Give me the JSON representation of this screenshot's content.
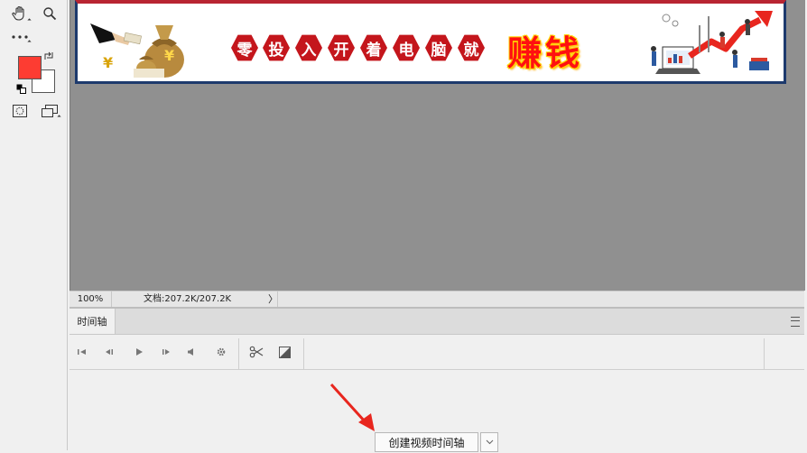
{
  "banner": {
    "chars": [
      "零",
      "投",
      "入",
      "开",
      "着",
      "电",
      "脑",
      "就"
    ],
    "highlight": "赚钱",
    "yen_symbol": "¥"
  },
  "status": {
    "zoom": "100%",
    "doc_info": "文档:207.2K/207.2K",
    "chevron": "〉"
  },
  "timeline": {
    "tab_label": "时间轴",
    "create_button": "创建视频时间轴"
  },
  "colors": {
    "foreground": "#fd3c32",
    "background": "#ffffff",
    "hex_red": "#c4161c",
    "accent_red": "#ff1010",
    "arrow_red": "#e8261e"
  },
  "icons": {
    "toolbar": [
      "hand-icon",
      "zoom-icon",
      "more-tools-icon",
      "swap-colors-icon",
      "default-colors-icon",
      "quick-mask-icon",
      "screen-mode-icon"
    ],
    "playback": [
      "first-frame-icon",
      "prev-frame-icon",
      "play-icon",
      "next-frame-icon",
      "audio-icon",
      "settings-icon",
      "split-icon",
      "transition-icon"
    ]
  }
}
